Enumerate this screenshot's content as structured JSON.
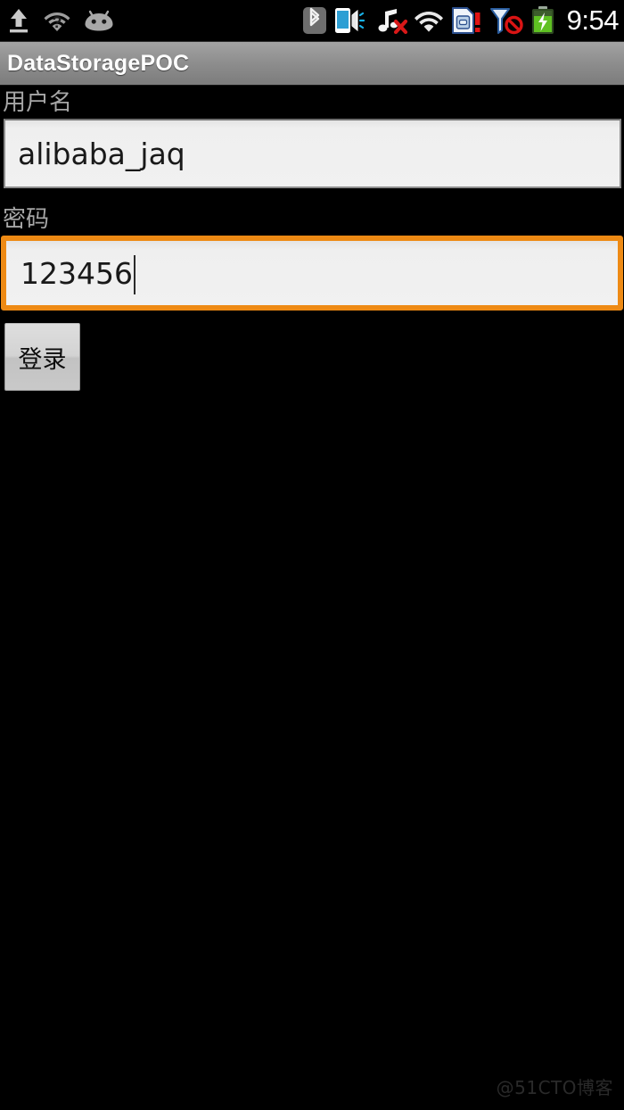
{
  "status_bar": {
    "left_icons": [
      {
        "name": "upload-icon",
        "title": "Upload in progress"
      },
      {
        "name": "wifi-question-icon",
        "title": "Wi-Fi sign-in required"
      },
      {
        "name": "android-head-icon",
        "title": "System update"
      }
    ],
    "right_icons": [
      {
        "name": "bluetooth-icon",
        "title": "Bluetooth on"
      },
      {
        "name": "phone-vibrate-icon",
        "title": "Ringer vibrate"
      },
      {
        "name": "music-muted-icon",
        "title": "Media muted"
      },
      {
        "name": "wifi-signal-icon",
        "title": "Wi-Fi connected"
      },
      {
        "name": "sim-alert-icon",
        "title": "SIM card problem"
      },
      {
        "name": "no-signal-icon",
        "title": "No mobile service"
      },
      {
        "name": "battery-charging-icon",
        "title": "Battery charging"
      }
    ],
    "clock": "9:54"
  },
  "title_bar": {
    "app_title": "DataStoragePOC"
  },
  "form": {
    "username": {
      "label": "用户名",
      "value": "alibaba_jaq",
      "placeholder": "",
      "focused": false
    },
    "password": {
      "label": "密码",
      "value": "123456",
      "placeholder": "",
      "focused": true
    },
    "login_button": {
      "label": "登录"
    }
  },
  "watermark": {
    "text": "@51CTO博客"
  },
  "colors": {
    "background": "#000000",
    "title_bar_top": "#a3a3a3",
    "title_bar_bottom": "#7c7c7c",
    "focus_orange": "#ee8a14",
    "field_fill": "#f1f1f1",
    "field_text": "#191919",
    "label_gray": "#a6a6a6",
    "status_text": "#ffffff",
    "watermark_gray": "#2a2a2a"
  }
}
